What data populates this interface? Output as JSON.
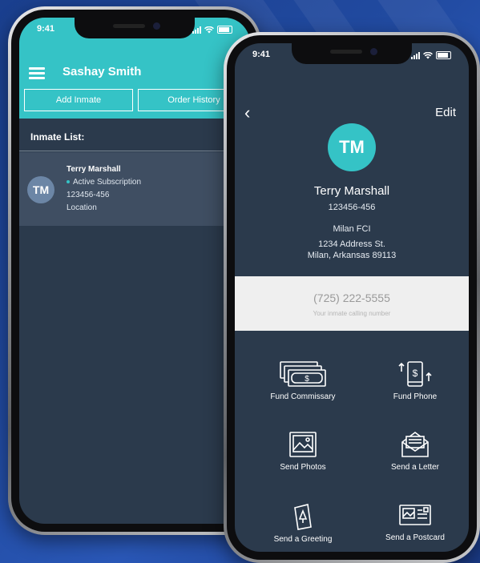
{
  "status_time": "9:41",
  "list_screen": {
    "user_name": "Sashay Smith",
    "buttons": {
      "add": "Add Inmate",
      "history": "Order History"
    },
    "list_heading": "Inmate List:",
    "inmate": {
      "initials": "TM",
      "name": "Terry Marshall",
      "subscription": "Active Subscription",
      "id": "123456-456",
      "location": "Location"
    }
  },
  "detail_screen": {
    "back_icon": "‹",
    "edit_label": "Edit",
    "initials": "TM",
    "name": "Terry Marshall",
    "id": "123456-456",
    "facility": "Milan FCI",
    "address_line1": "1234 Address St.",
    "address_line2": "Milan, Arkansas 89113",
    "calling_number": "(725) 222-5555",
    "calling_number_label": "Your inmate calling number",
    "actions": [
      {
        "label": "Fund Commissary",
        "icon": "cash-icon"
      },
      {
        "label": "Fund Phone",
        "icon": "phone-dollar-icon"
      },
      {
        "label": "Send Photos",
        "icon": "photo-icon"
      },
      {
        "label": "Send a Letter",
        "icon": "envelope-icon"
      },
      {
        "label": "Send a Greeting",
        "icon": "greeting-card-icon"
      },
      {
        "label": "Send a Postcard",
        "icon": "postcard-icon"
      }
    ]
  },
  "colors": {
    "accent": "#35c3c6",
    "screen_bg": "#2b3a4c",
    "row_bg": "#3f4e62",
    "background": "#214aa0"
  }
}
